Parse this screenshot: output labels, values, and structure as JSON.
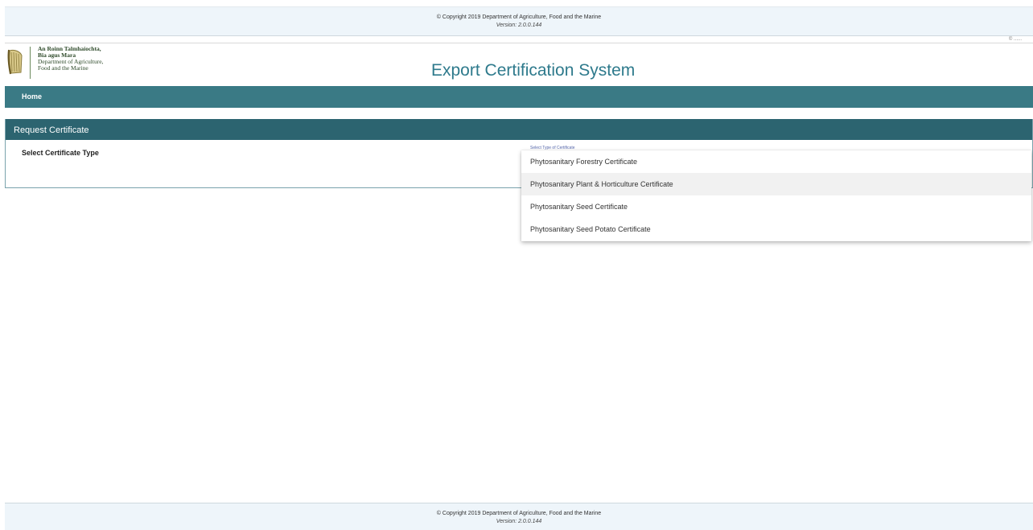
{
  "footer": {
    "copyright": "© Copyright 2019 Department of Agriculture, Food and the Marine",
    "version": "Version: 2.0.0.144"
  },
  "header": {
    "user_label": "© ......",
    "logo_line1": "An Roinn Talmhaíochta,",
    "logo_line2": "Bia agus Mara",
    "logo_line3": "Department of Agriculture,",
    "logo_line4": "Food and the Marine",
    "app_title": "Export Certification System"
  },
  "nav": {
    "home_label": "Home"
  },
  "panel": {
    "title": "Request Certificate",
    "field_label": "Select Certificate Type",
    "select_hint": "Select Type of Certificate"
  },
  "dropdown": {
    "options": [
      "Phytosanitary Forestry Certificate",
      "Phytosanitary Plant & Horticulture Certificate",
      "Phytosanitary Seed Certificate",
      "Phytosanitary Seed Potato Certificate"
    ],
    "highlighted_index": 1
  },
  "colors": {
    "brand_teal": "#2e7a8c",
    "nav_bg": "#3a7a85",
    "panel_header_bg": "#2c6470",
    "footer_bg": "#eef5fa"
  }
}
